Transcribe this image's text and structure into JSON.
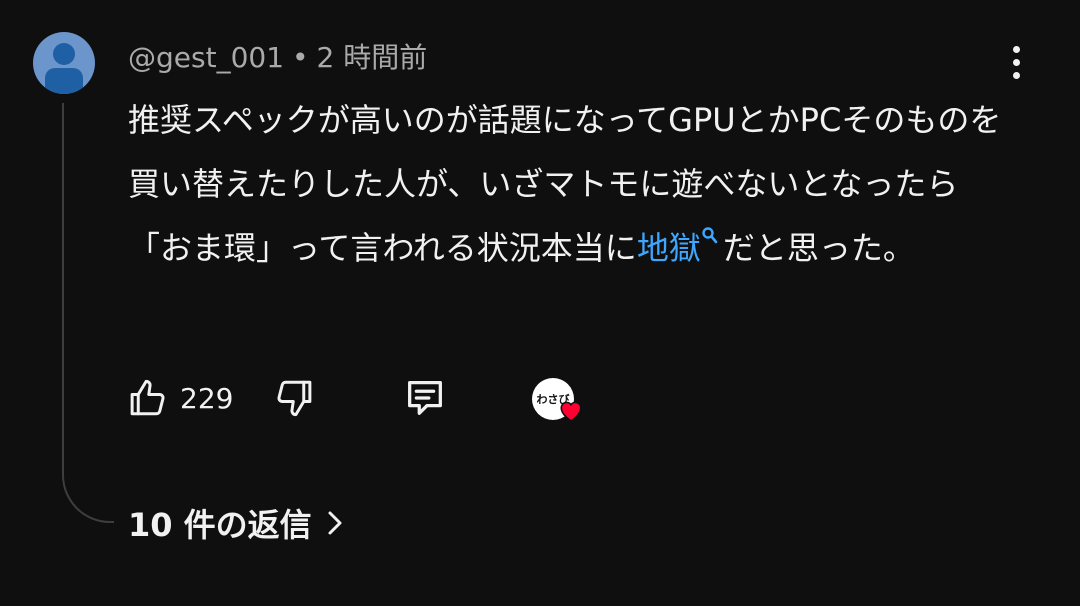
{
  "comment": {
    "author": "@gest_001",
    "separator": "•",
    "time": "2 時間前",
    "text_before_link": "推奨スペックが高いのが話題になってGPUとかPCそのものを買い替えたりした人が、いざマトモに遊べないとなったら「おま環」って言われる状況本当に",
    "link_text": "地獄",
    "text_after_link": "だと思った。",
    "like_count": "229",
    "creator_avatar_text": "わさび",
    "replies_label": "10 件の返信"
  },
  "icons": {
    "menu": "more-vert-icon",
    "like": "thumbs-up-icon",
    "dislike": "thumbs-down-icon",
    "reply": "comment-icon",
    "search": "search-icon",
    "heart": "heart-icon",
    "chevron": "chevron-right-icon"
  },
  "colors": {
    "background": "#0f0f0f",
    "text": "#f1f1f1",
    "meta": "#aaaaaa",
    "link": "#3ea6ff",
    "heart": "#ff0033",
    "avatar_bg": "#6c95cc"
  }
}
